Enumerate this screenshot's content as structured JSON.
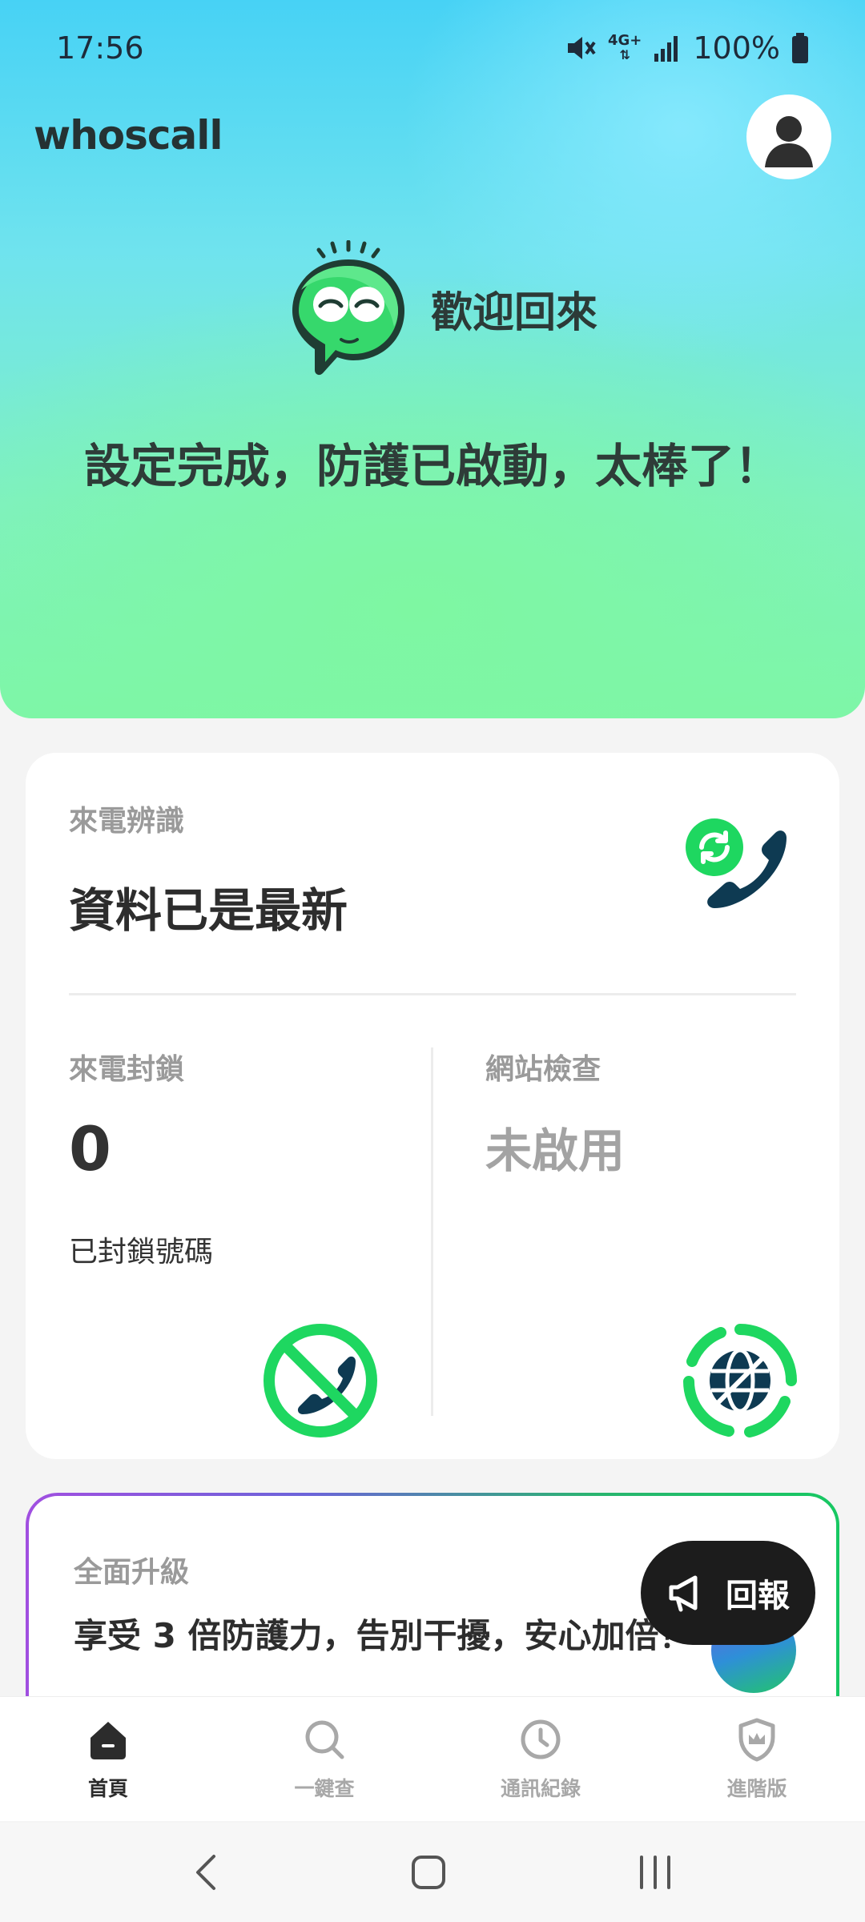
{
  "status_bar": {
    "time": "17:56",
    "network": "4G+",
    "battery": "100%"
  },
  "header": {
    "brand": "whoscall",
    "welcome": "歡迎回來",
    "title": "設定完成，防護已啟動，太棒了！"
  },
  "caller_id": {
    "label": "來電辨識",
    "status": "資料已是最新"
  },
  "call_block": {
    "label": "來電封鎖",
    "count": "0",
    "caption": "已封鎖號碼"
  },
  "web_check": {
    "label": "網站檢查",
    "status": "未啟用"
  },
  "upgrade": {
    "label": "全面升級",
    "text": "享受 3 倍防護力，告別干擾，安心加倍！"
  },
  "report_button": {
    "label": "回報"
  },
  "bottom_nav": {
    "items": [
      {
        "label": "首頁",
        "icon": "home-icon",
        "active": true
      },
      {
        "label": "一鍵查",
        "icon": "search-icon",
        "active": false
      },
      {
        "label": "通訊紀錄",
        "icon": "clock-icon",
        "active": false
      },
      {
        "label": "進階版",
        "icon": "shield-crown-icon",
        "active": false
      }
    ]
  },
  "colors": {
    "accent_green": "#1ed760",
    "navy": "#0e3a52",
    "dark": "#1c1c1c"
  }
}
